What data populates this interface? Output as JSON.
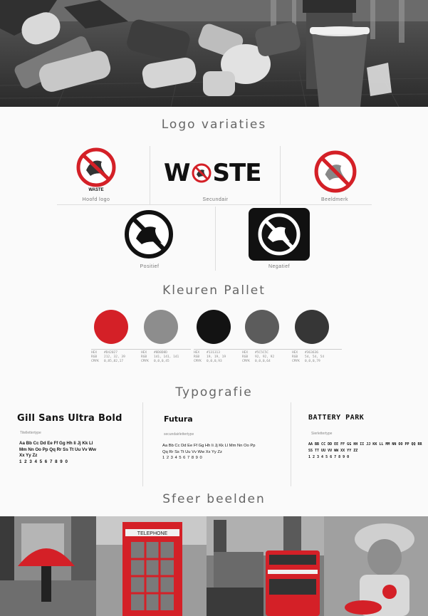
{
  "sections": {
    "logo_title": "Logo variaties",
    "palette_title": "Kleuren Pallet",
    "typo_title": "Typografie",
    "mood_title": "Sfeer beelden"
  },
  "logos": {
    "main_caption": "Hoofd logo",
    "main_wordmark": "WASTE",
    "secondary_text_1": "W",
    "secondary_text_2": "STE",
    "secondary_caption": "Secundair",
    "symbol_caption": "Beeldmerk",
    "positive_caption": "Positief",
    "negative_caption": "Negatief",
    "accent": "#d42027"
  },
  "palette": [
    {
      "color": "#d42027",
      "hex": "#D42027",
      "rgb": "212, 32, 39",
      "cmyk": "0,85,82,17"
    },
    {
      "color": "#8d8d8d",
      "hex": "#8D8D8D",
      "rgb": "141, 141, 141",
      "cmyk": "0,0,0,45"
    },
    {
      "color": "#131313",
      "hex": "#131313",
      "rgb": "19, 19, 19",
      "cmyk": "0,0,0,93"
    },
    {
      "color": "#5c5c5c",
      "hex": "#5C5C5C",
      "rgb": "92, 92, 92",
      "cmyk": "0,0,0,64"
    },
    {
      "color": "#363636",
      "hex": "#363636",
      "rgb": "54, 54, 54",
      "cmyk": "0,0,0,79"
    }
  ],
  "palette_keys": {
    "hex": "HEX",
    "rgb": "RGB",
    "cmyk": "CMYK"
  },
  "typography": [
    {
      "name": "Gill Sans Ultra Bold",
      "role": "Titellettertype",
      "sample_1": "Aa Bb Cc Dd Ee Ff Gg Hh Ii Jj Kk Ll",
      "sample_2": "Mm Nn Oo Pp Qq Rr Ss Tt Uu Vv Ww",
      "sample_3": "Xx Yy Zz",
      "digits": "1 2 3 4 5 6 7 8 9 0"
    },
    {
      "name": "Futura",
      "role": "secundairlettertype",
      "sample_1": "Aa Bb Cc Dd Ee Ff Gg Hh Ii Jj Kk Ll Mm Nn Oo Pp",
      "sample_2": "Qq Rr Ss Tt Uu Vv Ww Xx Yy Zz",
      "digits": "1 2 3 4 5 6 7 8 9 0"
    },
    {
      "name": "BATTERY PARK",
      "role": "Sierlettertype",
      "sample_1": "AA BB CC DD EE FF GG HH II JJ KK LL MM NN OO PP QQ RR",
      "sample_2": "SS TT UU VV WW XX YY ZZ",
      "digits": "1 2 3 4 5 6 7 8 9 0"
    }
  ],
  "mood": {
    "phone_sign": "TELEPHONE"
  }
}
